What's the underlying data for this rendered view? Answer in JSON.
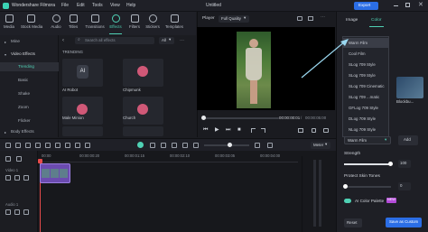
{
  "app": {
    "name": "Wondershare Filmora",
    "menu": [
      "File",
      "Edit",
      "Tools",
      "View",
      "Help"
    ],
    "project_title": "Untitled",
    "export_label": "Export"
  },
  "toolbar": {
    "tools": [
      {
        "label": "Media",
        "icon": "media-icon"
      },
      {
        "label": "Stock Media",
        "icon": "stock-media-icon"
      },
      {
        "label": "Audio",
        "icon": "audio-icon"
      },
      {
        "label": "Titles",
        "icon": "titles-icon"
      },
      {
        "label": "Transitions",
        "icon": "transitions-icon"
      },
      {
        "label": "Effects",
        "icon": "effects-icon"
      },
      {
        "label": "Filters",
        "icon": "filters-icon"
      },
      {
        "label": "Stickers",
        "icon": "stickers-icon"
      },
      {
        "label": "Templates",
        "icon": "templates-icon"
      }
    ],
    "active": "Effects"
  },
  "leftnav": {
    "items": [
      {
        "label": "Mine",
        "kind": "group"
      },
      {
        "label": "Video Effects",
        "kind": "group"
      },
      {
        "label": "Trending",
        "kind": "item"
      },
      {
        "label": "Basic",
        "kind": "item"
      },
      {
        "label": "Shake",
        "kind": "item"
      },
      {
        "label": "Zoom",
        "kind": "item"
      },
      {
        "label": "Flicker",
        "kind": "item"
      },
      {
        "label": "Body Effects",
        "kind": "group"
      }
    ],
    "selected": "Trending"
  },
  "effects": {
    "search_placeholder": "Search all effects",
    "filter_label": "All",
    "section_title": "TRENDING",
    "cards": [
      {
        "label": "AI Robot"
      },
      {
        "label": "Chipmunk"
      },
      {
        "label": "Male Minion"
      },
      {
        "label": "Church"
      }
    ]
  },
  "player": {
    "label": "Player",
    "quality": "Full Quality",
    "time_current": "00:00:00:01",
    "time_total": "00:00:05:00"
  },
  "right": {
    "tabs": [
      "Image",
      "Color"
    ],
    "active_tab": "Color",
    "thumb_label": "Blockbu...",
    "dropdown_options": [
      "Warm Film",
      "Cool Film",
      "SLog 709 Style",
      "SLog 709 Style",
      "SLog 709 Cinematic",
      "SLog 709 ...matic",
      "GFLog 709 Style",
      "DLog 709 Style",
      "NLog 709 Style"
    ],
    "dropdown_selected": "Warm Film",
    "add_label": "Add",
    "strength_label": "Strength",
    "strength_value": "100",
    "protect_label": "Protect Skin Tones",
    "protect_value": "0",
    "ai_palette_label": "AI Color Palette",
    "ai_badge": "NEW",
    "reset_label": "Reset",
    "save_label": "Save as Custom"
  },
  "timeline": {
    "meter_label": "Meter",
    "ruler": [
      "00:00",
      "00:00:00:20",
      "00:00:01:15",
      "00:00:02:10",
      "00:00:03:05",
      "00:00:04:00",
      "00:00:04:20"
    ],
    "track_video": "Video 1",
    "track_audio": "Audio 1",
    "clip_color": "#6b4bb0",
    "playhead_color": "#e84b4b"
  },
  "colors": {
    "accent": "#4fd1b4",
    "export": "#2b6ee6"
  }
}
